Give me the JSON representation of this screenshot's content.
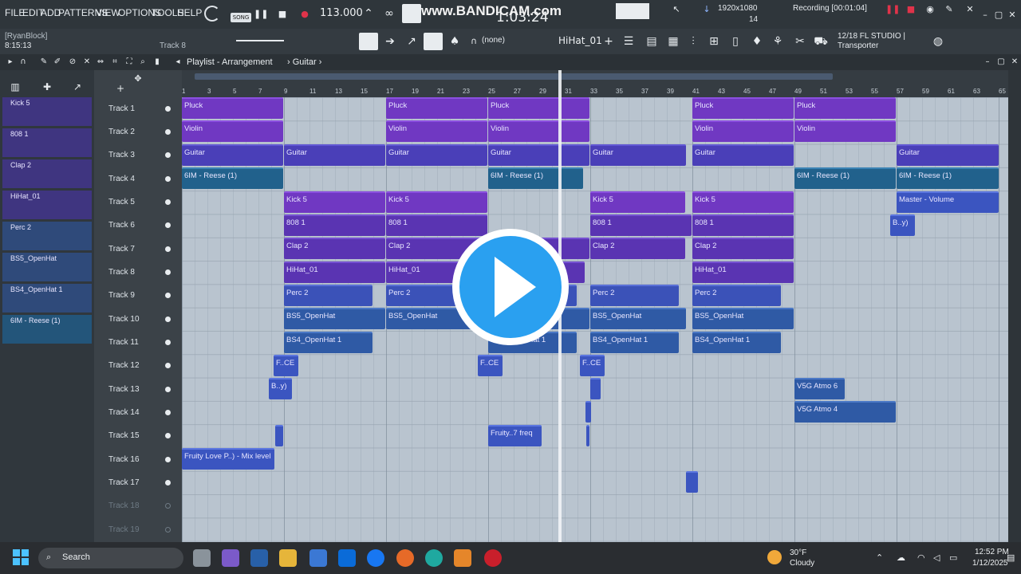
{
  "menu": [
    "FILE",
    "EDIT",
    "ADD",
    "PATTERNS",
    "VIEW",
    "OPTIONS",
    "TOOLS",
    "HELP"
  ],
  "transport": {
    "song_label": "SONG",
    "tempo": "113.000",
    "time": "1:03:24"
  },
  "watermark": "www.BANDICAM.com",
  "recording": {
    "resolution": "1920x1080",
    "status": "Recording [00:01:04]",
    "cpu": "14"
  },
  "user": {
    "name": "[RyanBlock]",
    "time": "8:15:13",
    "track_hint": "Track 8"
  },
  "toolbar": {
    "pattern": "HiHat_01",
    "none_label": "(none)",
    "hint": "12/18  FL STUDIO |",
    "hint2": "Transporter"
  },
  "playlist": {
    "title": "Playlist - Arrangement",
    "breadcrumb": "Guitar"
  },
  "ruler": [
    "1",
    "3",
    "5",
    "7",
    "9",
    "11",
    "13",
    "15",
    "17",
    "19",
    "21",
    "23",
    "25",
    "27",
    "29",
    "31",
    "33",
    "35",
    "37",
    "39",
    "41",
    "43",
    "45",
    "47",
    "49",
    "51",
    "53",
    "55",
    "57",
    "59",
    "61",
    "63",
    "65"
  ],
  "channels": [
    "Kick 5",
    "808 1",
    "Clap 2",
    "HiHat_01",
    "Perc 2",
    "BS5_OpenHat",
    "BS4_OpenHat 1",
    "6IM - Reese (1)"
  ],
  "tracks": [
    "Track 1",
    "Track 2",
    "Track 3",
    "Track 4",
    "Track 5",
    "Track 6",
    "Track 7",
    "Track 8",
    "Track 9",
    "Track 10",
    "Track 11",
    "Track 12",
    "Track 13",
    "Track 14",
    "Track 15",
    "Track 16",
    "Track 17",
    "Track 18",
    "Track 19"
  ],
  "clip_labels": {
    "pluck": "Pluck",
    "violin": "Violin",
    "guitar": "Guitar",
    "reese": "6IM - Reese (1)",
    "kick": "Kick 5",
    "b808": "808 1",
    "clap": "Clap 2",
    "hihat": "HiHat_01",
    "perc": "Perc 2",
    "bs5": "BS5_OpenHat",
    "bs4": "BS4_OpenHat 1",
    "fce": "F..CE",
    "by": "B..y)",
    "v5g6": "V5G Atmo 6",
    "v5g4": "V5G Atmo 4",
    "fruity": "Fruity..7 freq",
    "fruitylove": "Fruity Love P..) - Mix level",
    "master": "Master - Volume"
  },
  "taskbar": {
    "search": "Search",
    "weather_temp": "30°F",
    "weather_desc": "Cloudy",
    "time": "12:52 PM",
    "date": "1/12/2025"
  },
  "colors": {
    "grid": "#b9c4cf",
    "purple": "#7038c2",
    "blue": "#2f5aa5",
    "accent": "#2aa0f0"
  }
}
